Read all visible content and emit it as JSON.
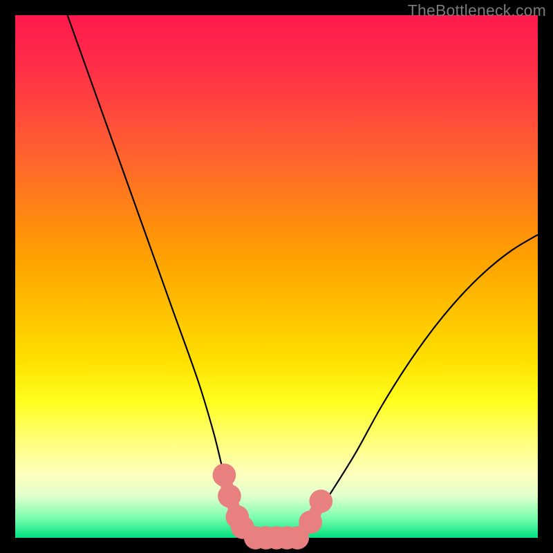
{
  "watermark": "TheBottleneck.com",
  "chart_data": {
    "type": "line",
    "title": "",
    "xlabel": "",
    "ylabel": "",
    "xlim": [
      0,
      100
    ],
    "ylim": [
      0,
      100
    ],
    "series": [
      {
        "name": "bottleneck-curve",
        "x": [
          10,
          15,
          20,
          25,
          30,
          35,
          38,
          40,
          42,
          44,
          46,
          48,
          50,
          52,
          54,
          56,
          60,
          65,
          70,
          75,
          80,
          85,
          90,
          95,
          100
        ],
        "y": [
          100,
          86,
          72,
          58,
          44,
          30,
          20,
          12,
          6,
          2,
          0,
          0,
          0,
          0,
          0,
          2,
          8,
          16,
          25,
          33,
          40,
          46,
          51,
          55,
          58
        ]
      }
    ],
    "markers": {
      "name": "highlighted-region",
      "points": [
        {
          "x": 40,
          "y": 12,
          "r": 2.6
        },
        {
          "x": 41,
          "y": 8,
          "r": 2.6
        },
        {
          "x": 42.5,
          "y": 4,
          "r": 2.6
        },
        {
          "x": 43.5,
          "y": 2,
          "r": 2.6
        },
        {
          "x": 46,
          "y": 0,
          "r": 2.6
        },
        {
          "x": 48,
          "y": 0,
          "r": 2.6
        },
        {
          "x": 50,
          "y": 0,
          "r": 2.6
        },
        {
          "x": 52,
          "y": 0,
          "r": 2.6
        },
        {
          "x": 54,
          "y": 0,
          "r": 2.6
        },
        {
          "x": 56.5,
          "y": 3,
          "r": 2.6
        },
        {
          "x": 58.5,
          "y": 7,
          "r": 2.6
        }
      ]
    }
  }
}
